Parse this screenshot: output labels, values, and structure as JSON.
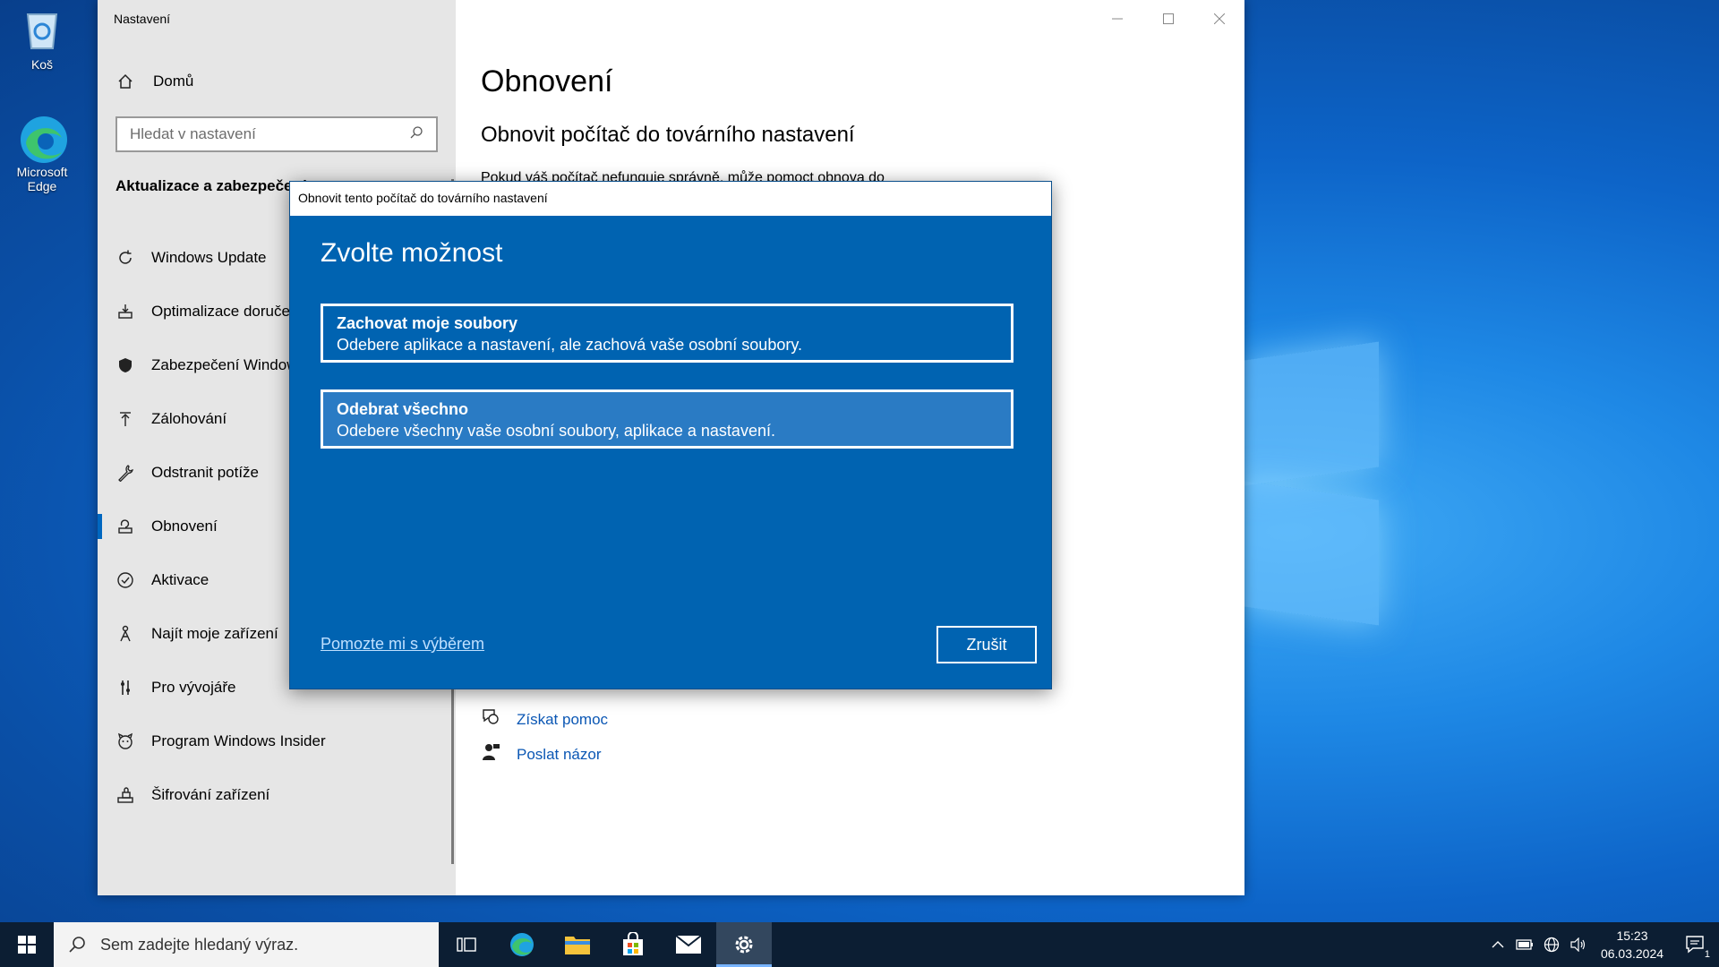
{
  "desktop": {
    "icons": [
      {
        "label": "Koš"
      },
      {
        "label": "Microsoft Edge"
      }
    ]
  },
  "settings": {
    "window_title": "Nastavení",
    "home_label": "Domů",
    "search_placeholder": "Hledat v nastavení",
    "section_title": "Aktualizace a zabezpečení",
    "nav": [
      {
        "label": "Windows Update",
        "icon": "refresh-icon"
      },
      {
        "label": "Optimalizace doručení",
        "icon": "delivery-icon"
      },
      {
        "label": "Zabezpečení Windows",
        "icon": "shield-icon"
      },
      {
        "label": "Zálohování",
        "icon": "backup-arrow-icon"
      },
      {
        "label": "Odstranit potíže",
        "icon": "wrench-icon"
      },
      {
        "label": "Obnovení",
        "icon": "recovery-icon",
        "active": true
      },
      {
        "label": "Aktivace",
        "icon": "check-circle-icon"
      },
      {
        "label": "Najít moje zařízení",
        "icon": "find-device-icon"
      },
      {
        "label": "Pro vývojáře",
        "icon": "developer-icon"
      },
      {
        "label": "Program Windows Insider",
        "icon": "insider-icon"
      },
      {
        "label": "Šifrování zařízení",
        "icon": "encryption-icon"
      }
    ],
    "page_title": "Obnovení",
    "sub_title": "Obnovit počítač do továrního nastavení",
    "body_text": "Pokud váš počítač nefunguje správně, může pomoct obnova do",
    "help_links": {
      "get_help": "Získat pomoc",
      "feedback": "Poslat názor"
    }
  },
  "dialog": {
    "title": "Obnovit tento počítač do továrního nastavení",
    "heading": "Zvolte možnost",
    "options": [
      {
        "title": "Zachovat moje soubory",
        "desc": "Odebere aplikace a nastavení, ale zachová vaše osobní soubory."
      },
      {
        "title": "Odebrat všechno",
        "desc": "Odebere všechny vaše osobní soubory, aplikace a nastavení."
      }
    ],
    "help_link": "Pomozte mi s výběrem",
    "cancel_label": "Zrušit"
  },
  "taskbar": {
    "search_placeholder": "Sem zadejte hledaný výraz.",
    "time": "15:23",
    "date": "06.03.2024",
    "notification_count": "1"
  },
  "colors": {
    "dialog_bg": "#0063b1",
    "accent": "#0067c0",
    "taskbar": "#0c1e33"
  }
}
